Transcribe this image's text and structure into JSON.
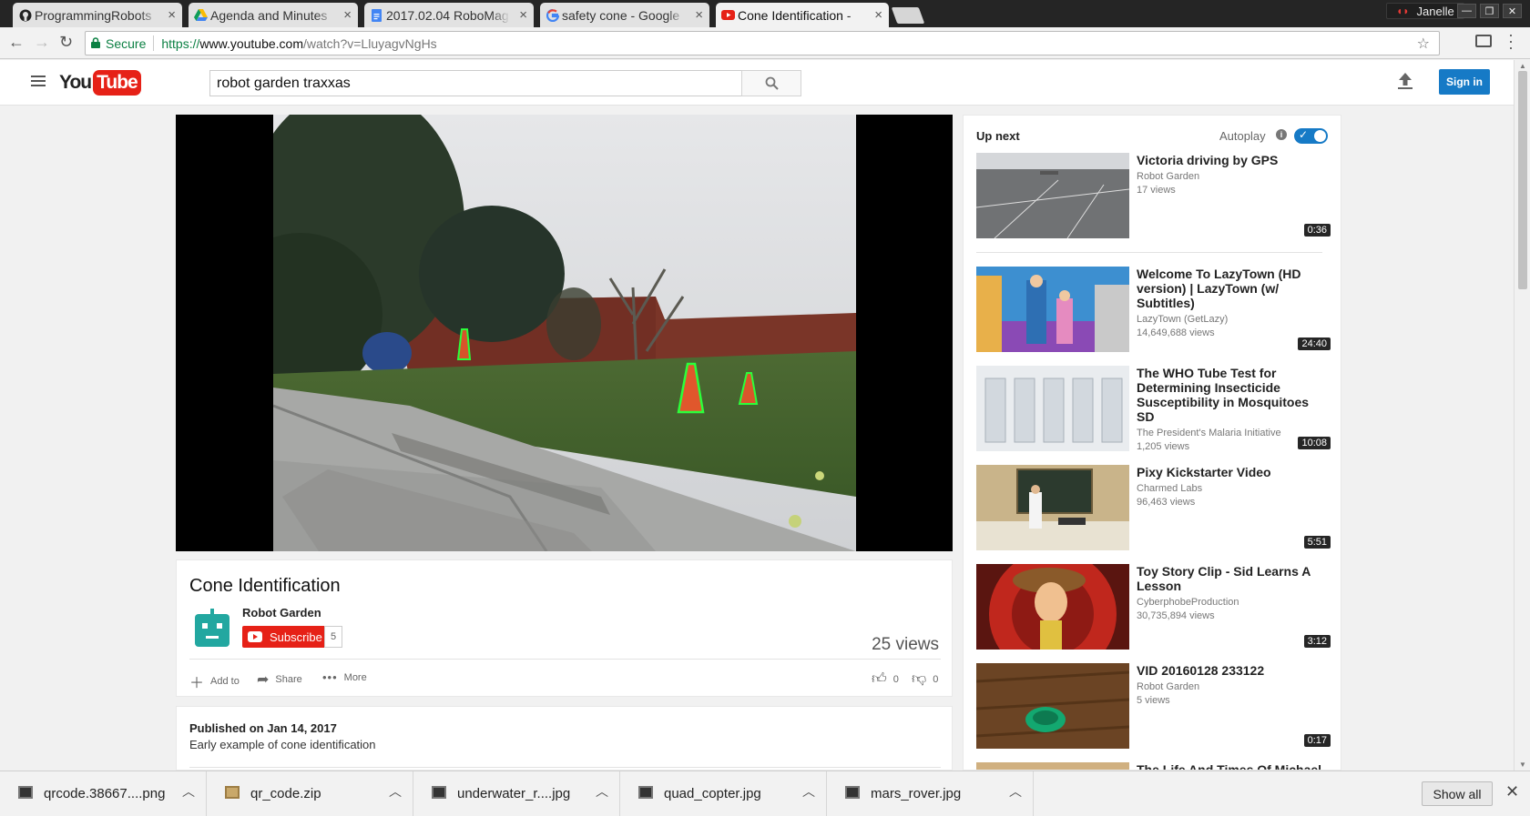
{
  "browser": {
    "tabs": [
      {
        "title": "ProgrammingRobots",
        "close": "×"
      },
      {
        "title": "Agenda and Minutes",
        "close": "×"
      },
      {
        "title": "2017.02.04 RoboMag",
        "close": "×"
      },
      {
        "title": "safety cone - Google",
        "close": "×"
      },
      {
        "title": "Cone Identification -",
        "close": "×"
      }
    ],
    "profile_name": "Janelle",
    "secure_label": "Secure",
    "url_scheme": "https://",
    "url_host": "www.youtube.com",
    "url_path": "/watch?v=LluyagvNgHs"
  },
  "youtube": {
    "logo_you": "You",
    "logo_tube": "Tube",
    "search_query": "robot garden traxxas",
    "sign_in": "Sign in"
  },
  "video": {
    "title": "Cone Identification",
    "channel": "Robot Garden",
    "subscribe_label": "Subscribe",
    "subscriber_count": "5",
    "views": "25 views",
    "actions": {
      "add_to": "Add to",
      "share": "Share",
      "more": "More"
    },
    "likes": "0",
    "dislikes": "0",
    "published": "Published on Jan 14, 2017",
    "description": "Early example of cone identification"
  },
  "sidebar": {
    "up_next": "Up next",
    "autoplay": "Autoplay",
    "info_glyph": "i",
    "videos": [
      {
        "title": "Victoria driving by GPS",
        "channel": "Robot Garden",
        "views": "17 views",
        "duration": "0:36"
      },
      {
        "title": "Welcome To LazyTown (HD version) | LazyTown (w/ Subtitles)",
        "channel": "LazyTown (GetLazy)",
        "views": "14,649,688 views",
        "duration": "24:40"
      },
      {
        "title": "The WHO Tube Test for Determining Insecticide Susceptibility in Mosquitoes SD",
        "channel": "The President's Malaria Initiative",
        "views": "1,205 views",
        "duration": "10:08"
      },
      {
        "title": "Pixy Kickstarter Video",
        "channel": "Charmed Labs",
        "views": "96,463 views",
        "duration": "5:51"
      },
      {
        "title": "Toy Story Clip - Sid Learns A Lesson",
        "channel": "CyberphobeProduction",
        "views": "30,735,894 views",
        "duration": "3:12"
      },
      {
        "title": "VID 20160128 233122",
        "channel": "Robot Garden",
        "views": "5 views",
        "duration": "0:17"
      },
      {
        "title": "The Life And Times Of Michael",
        "channel": "",
        "views": "",
        "duration": ""
      }
    ]
  },
  "downloads": {
    "items": [
      {
        "name": "qrcode.38667....png",
        "icon": "image-file-icon"
      },
      {
        "name": "qr_code.zip",
        "icon": "zip-file-icon"
      },
      {
        "name": "underwater_r....jpg",
        "icon": "image-file-icon"
      },
      {
        "name": "quad_copter.jpg",
        "icon": "image-file-icon"
      },
      {
        "name": "mars_rover.jpg",
        "icon": "image-file-icon"
      }
    ],
    "show_all": "Show all"
  }
}
